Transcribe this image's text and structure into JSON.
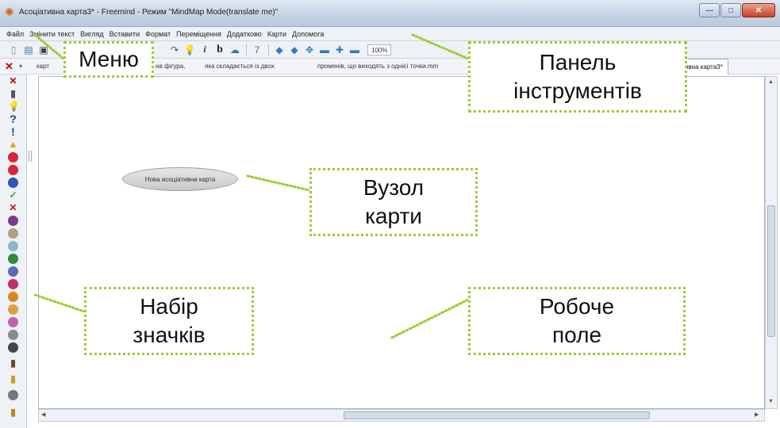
{
  "window": {
    "title": "Асоціативна карта3* - Freemind - Режим \"MindMap Mode(translate me)\"",
    "controls": [
      "—",
      "□",
      "✕"
    ]
  },
  "menu": [
    "Файл",
    "Змінити текст",
    "Вигляд",
    "Вставити",
    "Формат",
    "Переміщення",
    "Додатково",
    "Карти",
    "Допомога"
  ],
  "toolbar": {
    "zoom": "100%",
    "icons": [
      "new-icon",
      "open-icon",
      "save-icon",
      "redo-icon",
      "bulb-icon",
      "italic-icon",
      "bold-icon",
      "cloud-icon",
      "edge-icon",
      "arrow-left-icon",
      "arrow-right-icon",
      "star-icon",
      "minus-icon",
      "plus-icon",
      "line-icon"
    ]
  },
  "tabs": {
    "text_1": "карт",
    "text_2": "на фігура,",
    "text_3": "яка складається із двох",
    "text_4": "променів, що виходять з однієї точки.mm",
    "active": "ативна карта3*"
  },
  "map": {
    "node_text": "Нова асоціативна карта"
  },
  "callouts": {
    "menu": "Меню",
    "toolbar_line1": "Панель",
    "toolbar_line2": "інструментів",
    "node_line1": "Вузол",
    "node_line2": "карти",
    "icons_line1": "Набір",
    "icons_line2": "значків",
    "work_line1": "Робоче",
    "work_line2": "поле"
  },
  "palette_icons": [
    "remove-last-icon",
    "remove-all-icon",
    "idea-icon",
    "question-icon",
    "important-icon",
    "warning-icon",
    "stop-icon",
    "stop-2-icon",
    "info-icon",
    "ok-icon",
    "cancel-icon",
    "priority-1-icon",
    "priority-2-icon",
    "priority-3-icon",
    "priority-4-icon",
    "priority-5-icon",
    "priority-6-icon",
    "priority-7-icon",
    "priority-8-icon",
    "priority-9-icon",
    "priority-0-icon",
    "clock-icon",
    "traffic-light-icon"
  ],
  "colors": {
    "callout_border": "#9acd32",
    "close_button": "#c8412a"
  }
}
